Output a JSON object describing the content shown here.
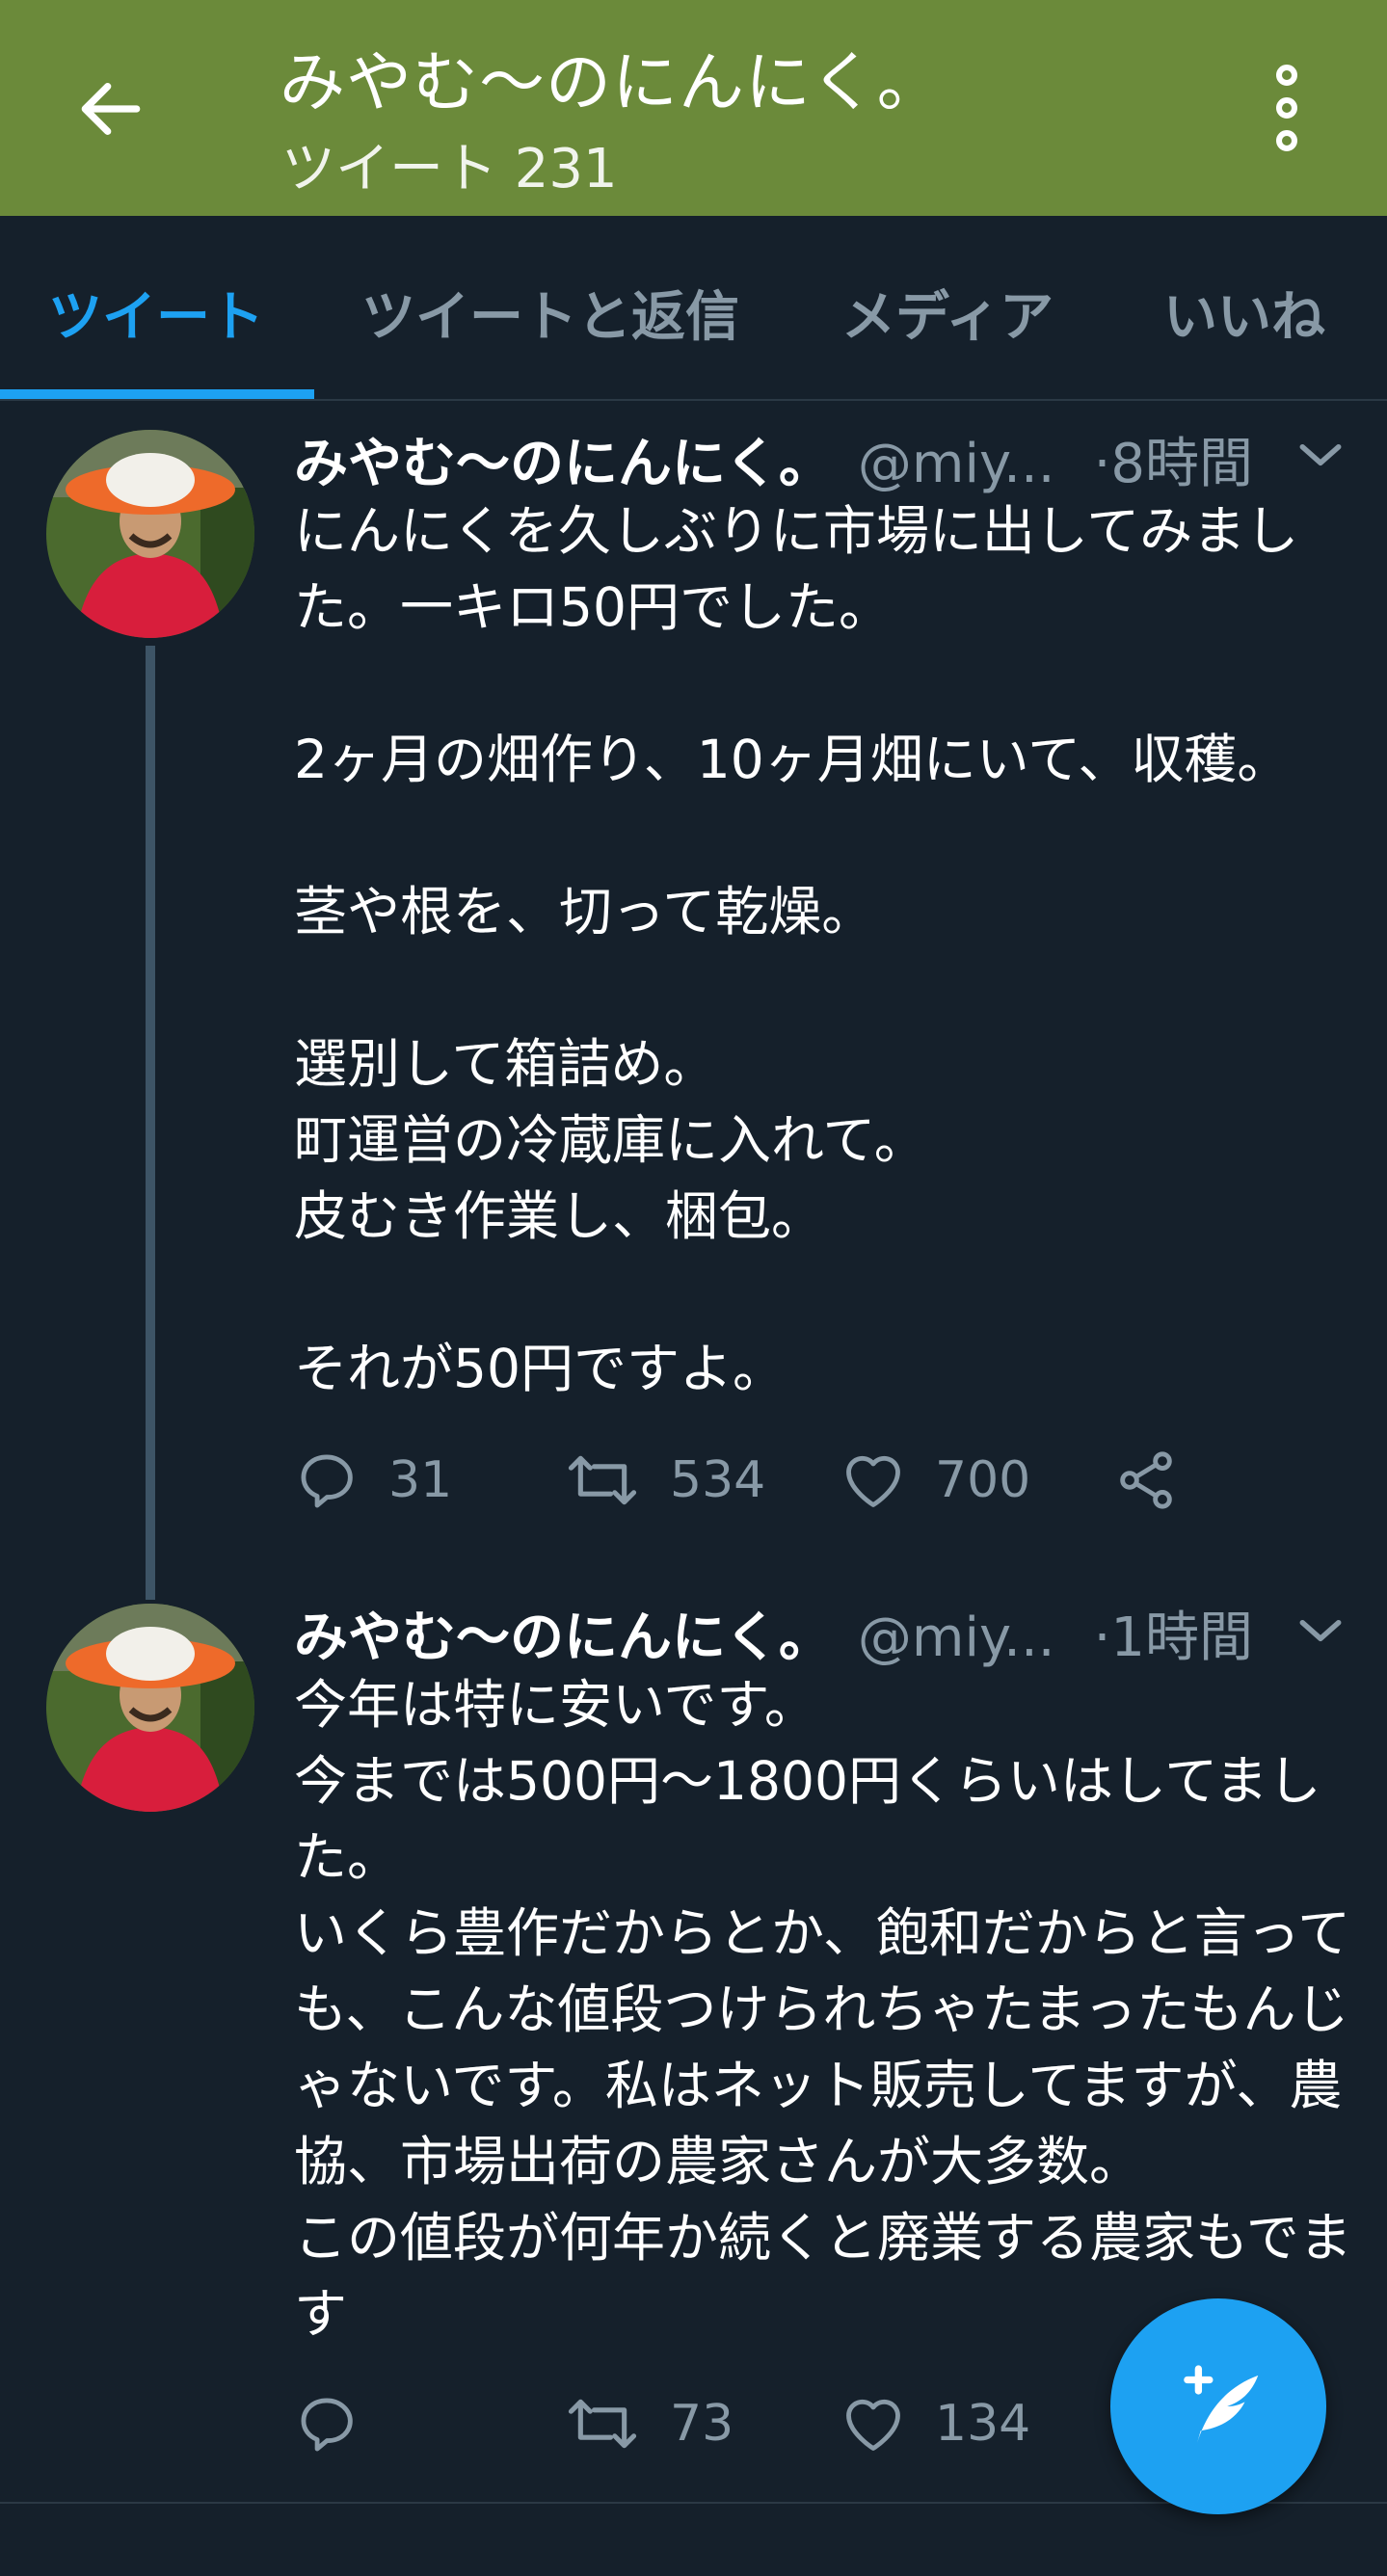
{
  "header": {
    "title": "みやむ〜のにんにく。",
    "subtitle": "ツイート 231",
    "back_icon": "arrow-left-icon",
    "menu_icon": "more-vertical-icon"
  },
  "tabs": [
    {
      "label": "ツイート",
      "active": true
    },
    {
      "label": "ツイートと返信",
      "active": false
    },
    {
      "label": "メディア",
      "active": false
    },
    {
      "label": "いいね",
      "active": false
    }
  ],
  "tweets": [
    {
      "name": "みやむ〜のにんにく。",
      "handle": "@miy...",
      "dot": "·",
      "time": "8時間",
      "text": "にんにくを久しぶりに市場に出してみました。一キロ50円でした。\n\n2ヶ月の畑作り、10ヶ月畑にいて、収穫。\n\n茎や根を、切って乾燥。\n\n選別して箱詰め。\n町運営の冷蔵庫に入れて。\n皮むき作業し、梱包。\n\nそれが50円ですよ。",
      "replies": "31",
      "retweets": "534",
      "likes": "700"
    },
    {
      "name": "みやむ〜のにんにく。",
      "handle": "@miy...",
      "dot": "·",
      "time": "1時間",
      "text": "今年は特に安いです。\n今までは500円〜1800円くらいはしてました。\nいくら豊作だからとか、飽和だからと言っても、こんな値段つけられちゃたまったもんじゃないです。私はネット販売してますが、農協、市場出荷の農家さんが大多数。\nこの値段が何年か続くと廃業する農家もでます",
      "replies": "",
      "retweets": "73",
      "likes": "134"
    }
  ],
  "colors": {
    "header_bg": "#6b8a3a",
    "background": "#15202b",
    "accent": "#1da1f2",
    "secondary_text": "#8899a6"
  },
  "fab": {
    "icon": "compose-tweet-icon"
  }
}
